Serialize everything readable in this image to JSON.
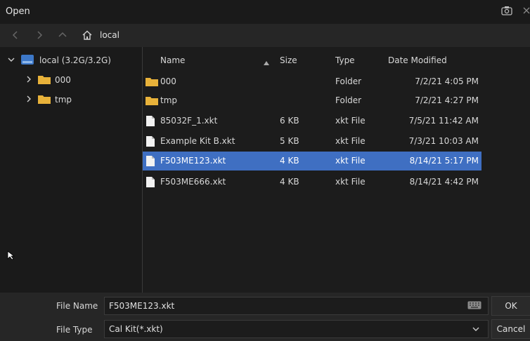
{
  "window": {
    "title": "Open"
  },
  "nav": {
    "location": "local"
  },
  "tree": [
    {
      "label": "local  (3.2G/3.2G)",
      "expanded": true
    },
    {
      "label": "000"
    },
    {
      "label": "tmp"
    }
  ],
  "columns": {
    "name": "Name",
    "size": "Size",
    "type": "Type",
    "date": "Date Modified"
  },
  "files": [
    {
      "name": "000",
      "size": "",
      "type": "Folder",
      "date": "7/2/21 4:05 PM",
      "kind": "folder"
    },
    {
      "name": "tmp",
      "size": "",
      "type": "Folder",
      "date": "7/2/21 4:27 PM",
      "kind": "folder"
    },
    {
      "name": "85032F_1.xkt",
      "size": "6 KB",
      "type": "xkt File",
      "date": "7/5/21 11:42 AM",
      "kind": "file"
    },
    {
      "name": "Example Kit B.xkt",
      "size": "5 KB",
      "type": "xkt File",
      "date": "7/3/21 10:03 AM",
      "kind": "file"
    },
    {
      "name": "F503ME123.xkt",
      "size": "4 KB",
      "type": "xkt File",
      "date": "8/14/21 5:17 PM",
      "kind": "file",
      "selected": true
    },
    {
      "name": "F503ME666.xkt",
      "size": "4 KB",
      "type": "xkt File",
      "date": "8/14/21 4:42 PM",
      "kind": "file"
    }
  ],
  "bottom": {
    "file_name_label": "File Name",
    "file_name_value": "F503ME123.xkt",
    "file_type_label": "File Type",
    "file_type_value": "Cal Kit(*.xkt)",
    "ok_label": "OK",
    "cancel_label": "Cancel"
  },
  "colors": {
    "selection": "#3f6fc2",
    "folder": "#e8b23a",
    "background": "#1c1c1c"
  }
}
